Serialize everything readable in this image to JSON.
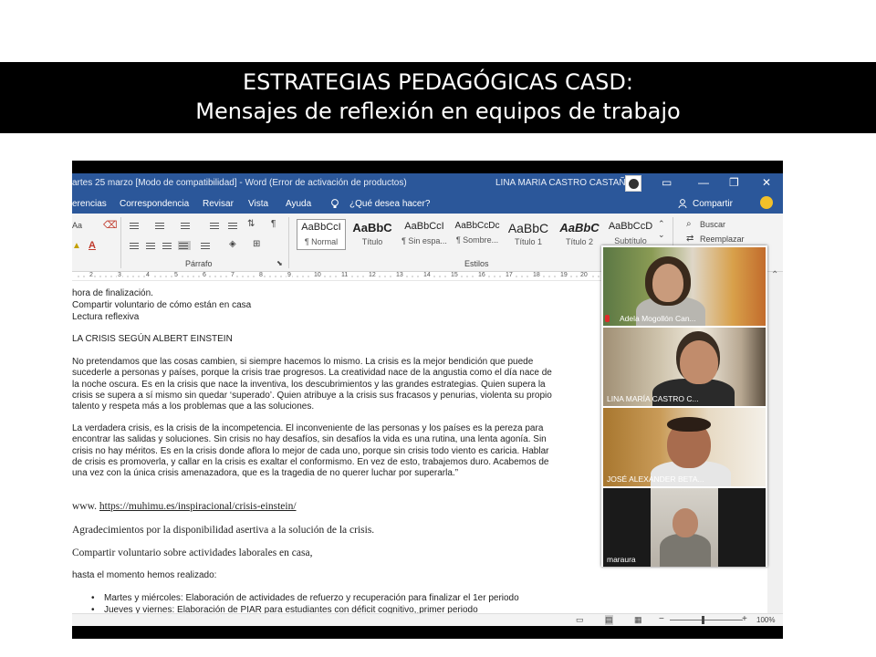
{
  "slide": {
    "title_line1": "ESTRATEGIAS PEDAGÓGICAS CASD:",
    "title_line2": "Mensajes de reflexión en equipos de trabajo"
  },
  "window": {
    "document_title": "artes 25 marzo [Modo de compatibilidad]  -  Word (Error de activación de productos)",
    "user_name": "LINA MARIA CASTRO CASTAÑO",
    "controls": [
      "▭",
      "—",
      "❐",
      "✕"
    ]
  },
  "menu": {
    "tabs": [
      "erencias",
      "Correspondencia",
      "Revisar",
      "Vista",
      "Ayuda"
    ],
    "tell_me": "¿Qué desea hacer?",
    "share": "Compartir"
  },
  "ribbon": {
    "font_size_label": "Aa",
    "paragraph_group": "Párrafo",
    "styles_group": "Estilos",
    "styles": [
      {
        "preview": "AaBbCcI",
        "name": "¶ Normal"
      },
      {
        "preview": "AaBbC",
        "name": "Título"
      },
      {
        "preview": "AaBbCcI",
        "name": "¶ Sin espa..."
      },
      {
        "preview": "AaBbCcDc",
        "name": "¶ Sombre..."
      },
      {
        "preview": "AaBbC",
        "name": "Título 1"
      },
      {
        "preview": "AaBbC",
        "name": "Título 2"
      },
      {
        "preview": "AaBbCcD",
        "name": "Subtítulo"
      }
    ],
    "find": "Buscar",
    "replace": "Reemplazar"
  },
  "ruler": {
    "numbers": [
      "2",
      "3",
      "4",
      "5",
      "6",
      "7",
      "8",
      "9",
      "10",
      "11",
      "12",
      "13",
      "14",
      "15",
      "16",
      "17",
      "18",
      "19",
      "20"
    ]
  },
  "document": {
    "line_finalizacion": "hora de finalización.",
    "line_compartir": "Compartir voluntario de cómo están en casa",
    "line_lectura": "Lectura reflexiva",
    "heading": "LA CRISIS SEGÚN ALBERT EINSTEIN",
    "para1": "No pretendamos que las cosas cambien, si siempre hacemos lo mismo. La crisis es la mejor bendición que puede sucederle a personas y países, porque la crisis trae progresos. La creatividad nace de la angustia como el día nace de la noche oscura. Es en la crisis que nace la inventiva, los descubrimientos y las grandes estrategias. Quien supera la crisis se supera a sí mismo sin quedar ‘superado’. Quien atribuye a la crisis sus fracasos y penurias, violenta su propio talento y respeta más a los problemas que a las soluciones.",
    "para2": "La verdadera crisis, es la crisis de la incompetencia. El inconveniente de las personas y los países es la pereza para encontrar las salidas y soluciones. Sin crisis no hay desafíos, sin desafíos la vida es una rutina, una lenta agonía. Sin crisis no hay méritos. Es en la crisis donde aflora lo mejor de cada uno, porque sin crisis todo viento es caricia. Hablar de crisis es promoverla, y callar en la crisis es exaltar el conformismo. En vez de esto, trabajemos duro. Acabemos de una vez con la única crisis amenazadora, que es la tragedia de no querer luchar por superarla.”",
    "source_prefix": "www.",
    "source_link": "https://muhimu.es/inspiracional/crisis-einstein/",
    "thanks": "Agradecimientos por la disponibilidad asertiva a la solución de la crisis.",
    "share_work": "Compartir voluntario sobre actividades laborales en casa,",
    "so_far": "hasta el momento hemos realizado:",
    "bullets": [
      "Martes y miércoles: Elaboración de actividades de refuerzo y recuperación para finalizar el 1er periodo",
      "Jueves y viernes: Elaboración de PIAR para estudiantes con déficit cognitivo, primer periodo"
    ]
  },
  "status": {
    "zoom": "100%"
  },
  "participants": [
    {
      "name": "Adela Mogollón Can...",
      "muted": true
    },
    {
      "name": "LINA MARÍA CASTRO C...",
      "muted": false
    },
    {
      "name": "JOSÉ ALEXANDER BETA...",
      "muted": false
    },
    {
      "name": "maraura",
      "muted": false
    }
  ]
}
